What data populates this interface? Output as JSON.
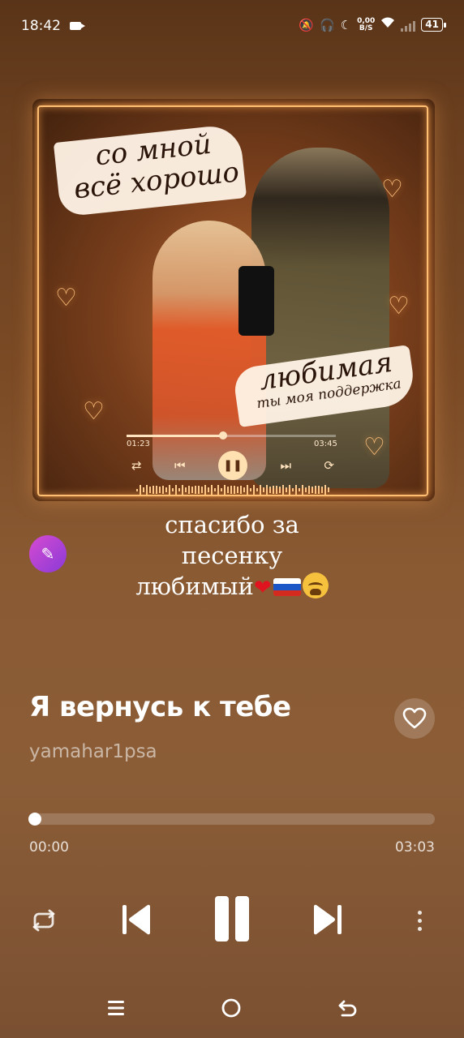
{
  "status_bar": {
    "time": "18:42",
    "speed_top": "0,00",
    "speed_bottom": "B/S",
    "battery": "41"
  },
  "cover": {
    "headline": "со мной всё хорошо",
    "tagline_big": "любимая",
    "tagline_small": "ты моя поддержка",
    "mini_time_current": "01:23",
    "mini_time_total": "03:45",
    "mini_progress": 0.46
  },
  "caption": {
    "line1": "спасибо за",
    "line2": "песенку",
    "line3": "любимый",
    "emoji_heart": "❤"
  },
  "track": {
    "title": "Я вернусь к тебе",
    "artist": "yamahar1psa"
  },
  "player": {
    "current_time": "00:00",
    "total_time": "03:03",
    "progress": 0.0
  },
  "colors": {
    "accent_glow": "#ffbf73",
    "magic_button": "#b442d4"
  },
  "icons": {
    "repeat": "repeat-icon",
    "previous": "previous-icon",
    "pause": "pause-icon",
    "next": "next-icon",
    "more": "more-vertical-icon",
    "like": "heart-outline-icon",
    "magic": "magic-wand-icon"
  }
}
